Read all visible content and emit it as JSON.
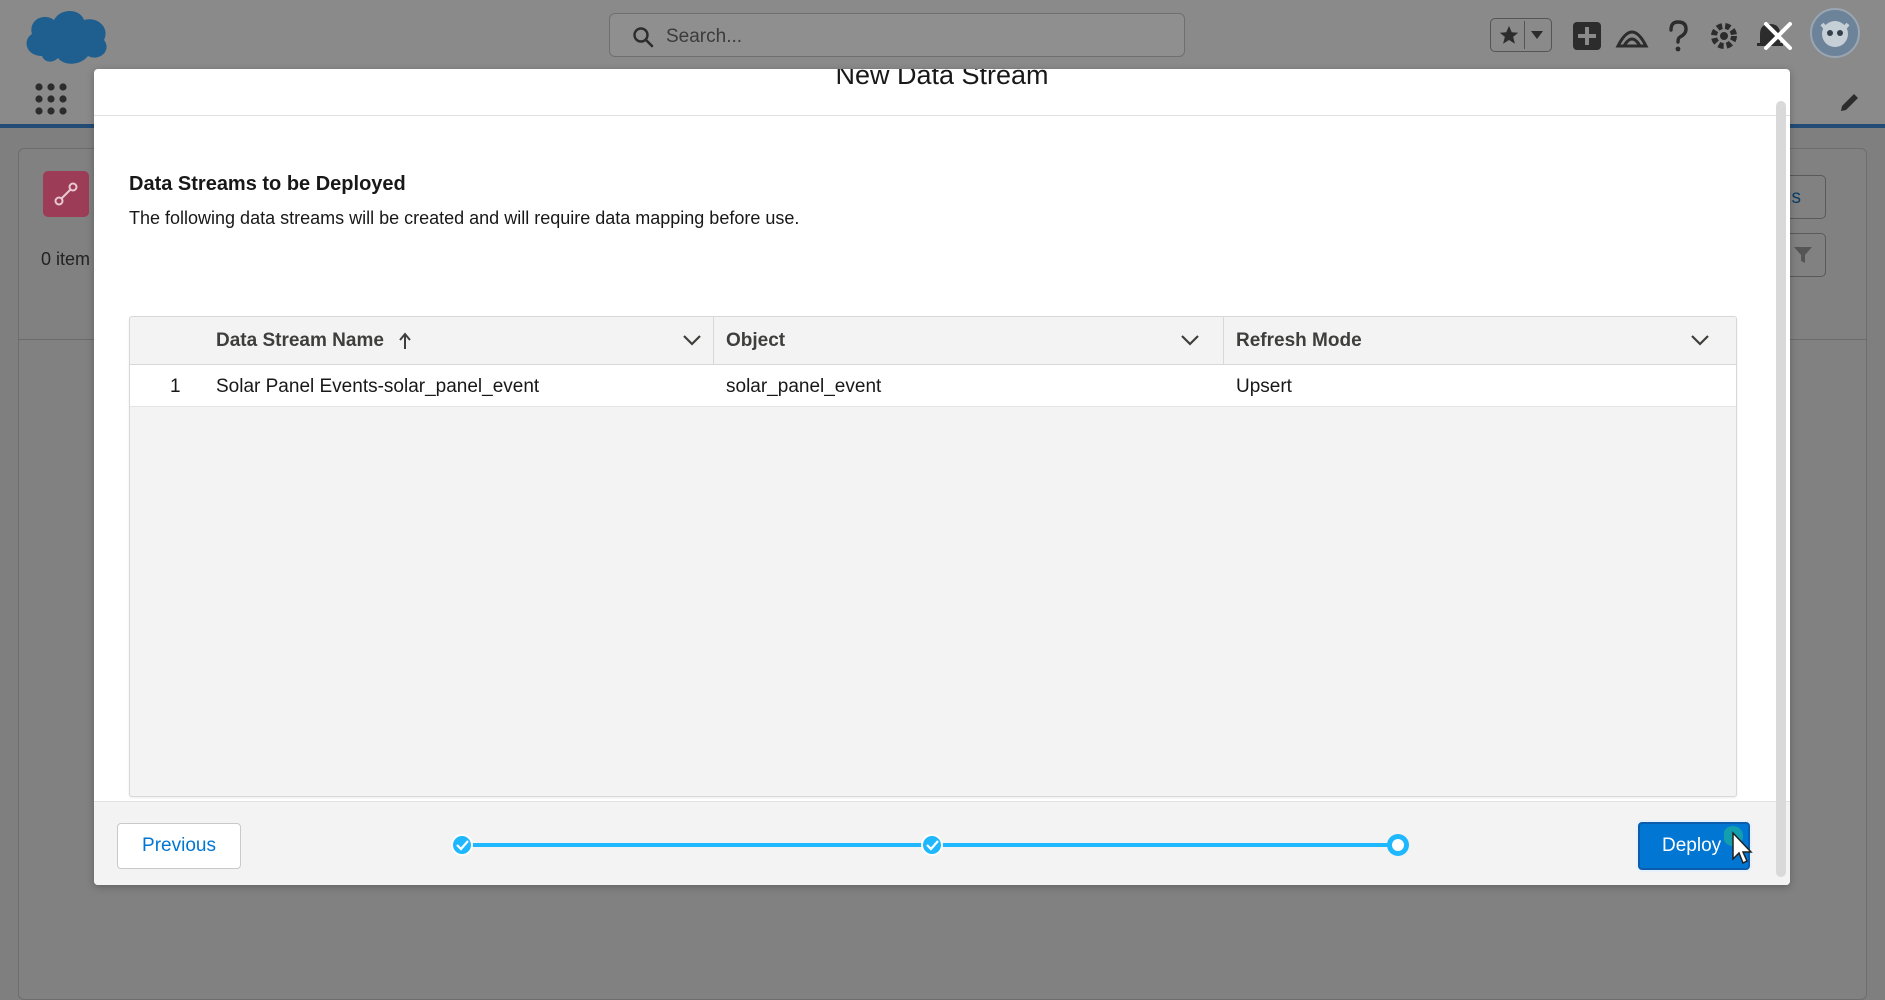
{
  "header": {
    "search_placeholder": "Search..."
  },
  "background": {
    "items_count_text": "0 item",
    "status_button_text": "tus"
  },
  "modal": {
    "title": "New Data Stream",
    "section_title": "Data Streams to be Deployed",
    "section_description": "The following data streams will be created and will require data mapping before use.",
    "table": {
      "columns": [
        "Data Stream Name",
        "Object",
        "Refresh Mode"
      ],
      "sort_column": "Data Stream Name",
      "sort_direction": "ascending",
      "rows": [
        {
          "row_number": "1",
          "data_stream_name": "Solar Panel Events-solar_panel_event",
          "object": "solar_panel_event",
          "refresh_mode": "Upsert"
        }
      ]
    },
    "footer": {
      "previous_label": "Previous",
      "deploy_label": "Deploy",
      "progress_steps": [
        {
          "state": "complete"
        },
        {
          "state": "complete"
        },
        {
          "state": "current"
        }
      ]
    }
  },
  "colors": {
    "brand_blue": "#0176d3",
    "progress_blue": "#1fb8ff",
    "overlay_gray": "#7f7f7f"
  },
  "icons": [
    "cloud-logo",
    "search-icon",
    "star-icon",
    "chevron-down-icon",
    "plus-icon",
    "trailhead-icon",
    "help-icon",
    "gear-icon",
    "bell-icon",
    "avatar",
    "app-launcher-icon",
    "pencil-icon",
    "close-icon",
    "sort-up-arrow-icon",
    "checkmark-icon",
    "filter-icon",
    "cursor-icon"
  ]
}
